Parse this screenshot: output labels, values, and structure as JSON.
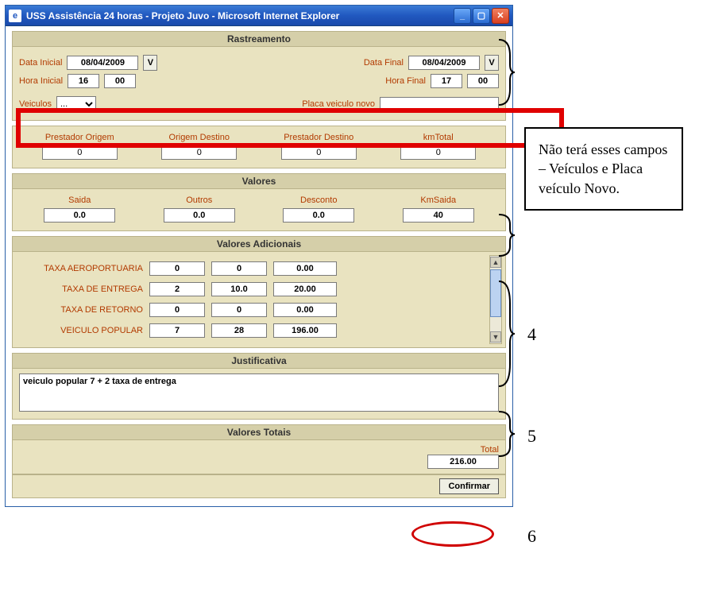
{
  "window": {
    "title": "USS Assistência 24 horas - Projeto Juvo - Microsoft Internet Explorer"
  },
  "rastreamento": {
    "title": "Rastreamento",
    "data_inicial_lbl": "Data Inicial",
    "data_inicial": "08/04/2009",
    "data_final_lbl": "Data Final",
    "data_final": "08/04/2009",
    "vbtn": "V",
    "hora_inicial_lbl": "Hora Inicial",
    "hora_inicial_h": "16",
    "hora_inicial_m": "00",
    "hora_final_lbl": "Hora Final",
    "hora_final_h": "17",
    "hora_final_m": "00",
    "veiculos_lbl": "Veiculos",
    "placa_lbl": "Placa veiculo novo",
    "placa": ""
  },
  "km": {
    "col1": "Prestador Origem",
    "col2": "Origem Destino",
    "col3": "Prestador Destino",
    "col4": "kmTotal",
    "v1": "0",
    "v2": "0",
    "v3": "0",
    "v4": "0"
  },
  "valores": {
    "title": "Valores",
    "c1": "Saida",
    "c2": "Outros",
    "c3": "Desconto",
    "c4": "KmSaida",
    "v1": "0.0",
    "v2": "0.0",
    "v3": "0.0",
    "v4": "40"
  },
  "adicionais": {
    "title": "Valores Adicionais",
    "rows": [
      {
        "label": "TAXA AEROPORTUARIA",
        "a": "0",
        "b": "0",
        "c": "0.00"
      },
      {
        "label": "TAXA DE ENTREGA",
        "a": "2",
        "b": "10.0",
        "c": "20.00"
      },
      {
        "label": "TAXA DE RETORNO",
        "a": "0",
        "b": "0",
        "c": "0.00"
      },
      {
        "label": "VEICULO POPULAR",
        "a": "7",
        "b": "28",
        "c": "196.00"
      }
    ]
  },
  "justificativa": {
    "title": "Justificativa",
    "text": "veiculo popular 7 + 2 taxa de entrega"
  },
  "totais": {
    "title": "Valores Totais",
    "total_lbl": "Total",
    "total": "216.00",
    "confirm": "Confirmar"
  },
  "annotation": {
    "text": "Não terá esses campos – Veículos e Placa veículo Novo.",
    "n4": "4",
    "n5": "5",
    "n6": "6"
  }
}
